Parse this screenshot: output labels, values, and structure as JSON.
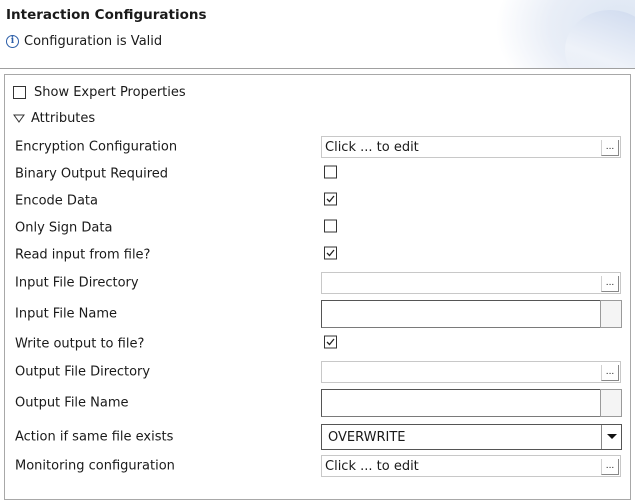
{
  "header": {
    "title": "Interaction Configurations",
    "status": "Configuration is Valid"
  },
  "panel": {
    "expert_label": "Show Expert Properties",
    "expert_checked": false,
    "attributes_label": "Attributes"
  },
  "fields": {
    "encryption_configuration": {
      "label": "Encryption Configuration",
      "value": "Click ... to edit",
      "button": "..."
    },
    "binary_output_required": {
      "label": "Binary Output Required",
      "checked": false
    },
    "encode_data": {
      "label": "Encode Data",
      "checked": true
    },
    "only_sign_data": {
      "label": "Only Sign Data",
      "checked": false
    },
    "read_input_from_file": {
      "label": "Read input from file?",
      "checked": true
    },
    "input_file_directory": {
      "label": "Input File Directory",
      "value": "",
      "button": "..."
    },
    "input_file_name": {
      "label": "Input File Name",
      "value": ""
    },
    "write_output_to_file": {
      "label": "Write output to file?",
      "checked": true
    },
    "output_file_directory": {
      "label": "Output File Directory",
      "value": "",
      "button": "..."
    },
    "output_file_name": {
      "label": "Output File Name",
      "value": ""
    },
    "action_if_same_file_exists": {
      "label": "Action if same file exists",
      "selected": "OVERWRITE"
    },
    "monitoring_configuration": {
      "label": "Monitoring configuration",
      "value": "Click ... to edit",
      "button": "..."
    }
  },
  "icons": {
    "info": "info-icon",
    "check": "checkmark-icon",
    "expand": "triangle-down-icon",
    "dropdown": "chevron-down-icon"
  }
}
